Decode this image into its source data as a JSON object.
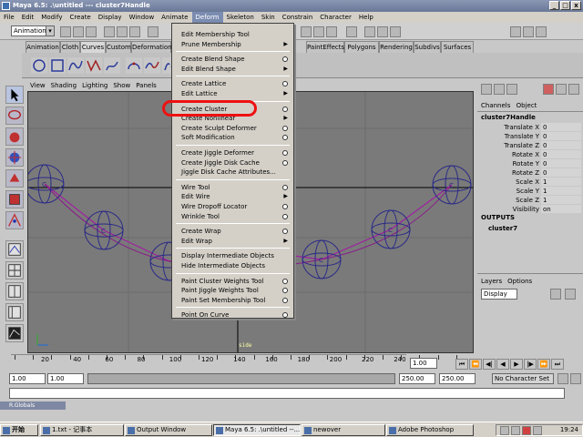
{
  "window": {
    "title": "Maya 6.5: .\\untitled   ---   cluster7Handle",
    "minimize": "_",
    "maximize": "□",
    "close": "x"
  },
  "menubar": [
    "File",
    "Edit",
    "Modify",
    "Create",
    "Display",
    "Window",
    "Animate",
    "Deform",
    "Skeleton",
    "Skin",
    "Constrain",
    "Character",
    "Help"
  ],
  "status_line": {
    "mode": "Animation"
  },
  "shelf_tabs": [
    "Animation",
    "Cloth",
    "Curves",
    "Custom",
    "Deformation",
    "PaintEffects",
    "Polygons",
    "Rendering",
    "Subdivs",
    "Surfaces"
  ],
  "viewport": {
    "menu": [
      "View",
      "Shading",
      "Lighting",
      "Show",
      "Panels"
    ],
    "camera_label": "side"
  },
  "deform_menu": [
    {
      "label": "Edit Membership Tool",
      "option": false
    },
    {
      "label": "Prune Membership",
      "submenu": true
    },
    {
      "sep": true
    },
    {
      "label": "Create Blend Shape",
      "option": true
    },
    {
      "label": "Edit Blend Shape",
      "submenu": true
    },
    {
      "sep": true
    },
    {
      "label": "Create Lattice",
      "option": true
    },
    {
      "label": "Edit Lattice",
      "submenu": true
    },
    {
      "sep": true
    },
    {
      "label": "Create Cluster",
      "option": true
    },
    {
      "label": "Create Nonlinear",
      "submenu": true
    },
    {
      "label": "Create Sculpt Deformer",
      "option": true
    },
    {
      "label": "Soft Modification",
      "option": true
    },
    {
      "sep": true
    },
    {
      "label": "Create Jiggle Deformer",
      "option": true
    },
    {
      "label": "Create Jiggle Disk Cache",
      "option": true
    },
    {
      "label": "Jiggle Disk Cache Attributes...",
      "option": false
    },
    {
      "sep": true
    },
    {
      "label": "Wire Tool",
      "option": true
    },
    {
      "label": "Edit Wire",
      "submenu": true
    },
    {
      "label": "Wire Dropoff Locator",
      "option": true
    },
    {
      "label": "Wrinkle Tool",
      "option": true
    },
    {
      "sep": true
    },
    {
      "label": "Create Wrap",
      "option": true
    },
    {
      "label": "Edit Wrap",
      "submenu": true
    },
    {
      "sep": true
    },
    {
      "label": "Display Intermediate Objects",
      "option": false
    },
    {
      "label": "Hide Intermediate Objects",
      "option": false
    },
    {
      "sep": true
    },
    {
      "label": "Paint Cluster Weights Tool",
      "option": true
    },
    {
      "label": "Paint Jiggle Weights Tool",
      "option": true
    },
    {
      "label": "Paint Set Membership Tool",
      "option": true
    },
    {
      "sep": true
    },
    {
      "label": "Point On Curve",
      "option": true
    }
  ],
  "channel_box": {
    "menu": [
      "Channels",
      "Object"
    ],
    "object": "cluster7Handle",
    "attributes": [
      {
        "name": "Translate X",
        "value": "0"
      },
      {
        "name": "Translate Y",
        "value": "0"
      },
      {
        "name": "Translate Z",
        "value": "0"
      },
      {
        "name": "Rotate X",
        "value": "0"
      },
      {
        "name": "Rotate Y",
        "value": "0"
      },
      {
        "name": "Rotate Z",
        "value": "0"
      },
      {
        "name": "Scale X",
        "value": "1"
      },
      {
        "name": "Scale Y",
        "value": "1"
      },
      {
        "name": "Scale Z",
        "value": "1"
      },
      {
        "name": "Visibility",
        "value": "on"
      }
    ],
    "outputs_label": "OUTPUTS",
    "output_node": "cluster7"
  },
  "layers": {
    "menu": [
      "Layers",
      "Options"
    ],
    "display": "Display"
  },
  "time_slider": {
    "ticks": [
      "20",
      "40",
      "60",
      "80",
      "100",
      "120",
      "140",
      "160",
      "180",
      "200",
      "220",
      "240"
    ],
    "current": "1.00"
  },
  "range_slider": {
    "start": "1.00",
    "range_start": "1.00",
    "range_end": "250.00",
    "end": "250.00",
    "character_set": "No Character Set"
  },
  "help_line": {
    "title": "R.Globals"
  },
  "taskbar": {
    "start": "开始",
    "items": [
      "1.txt - 记事本",
      "Output Window",
      "Maya 6.5: .\\untitled  --...",
      "newover",
      "Adobe Photoshop"
    ],
    "clock": "19:24"
  },
  "colors": {
    "highlight": "#ee1111",
    "viewport_bg": "#7a7a7a",
    "wire": "#2a2a88",
    "curve": "#a020a0"
  }
}
